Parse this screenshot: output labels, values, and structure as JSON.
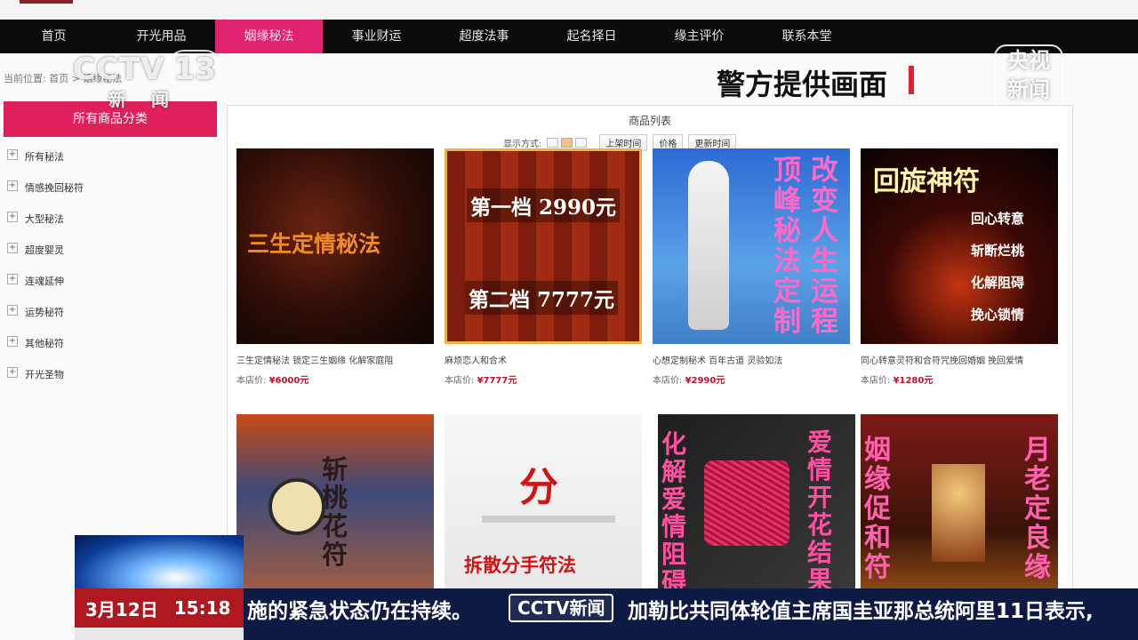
{
  "nav": {
    "items": [
      "首页",
      "开光用品",
      "姻缘秘法",
      "事业财运",
      "超度法事",
      "起名择日",
      "缘主评价",
      "联系本堂"
    ],
    "active_index": 2
  },
  "breadcrumb": "当前位置: 首页 > 姻缘秘法",
  "sidebar": {
    "header": "所有商品分类",
    "items": [
      "所有秘法",
      "情感挽回秘符",
      "大型秘法",
      "超度婴灵",
      "连魂延伸",
      "运势秘符",
      "其他秘符",
      "开光圣物"
    ]
  },
  "panel": {
    "title": "商品列表",
    "sort_label": "显示方式:",
    "sort_buttons": [
      "上架时间",
      "价格",
      "更新时间"
    ]
  },
  "products": [
    {
      "thumb_text": "三生定情秘法",
      "name": "三生定情秘法 锁定三生姻缘 化解家庭阻",
      "price_label": "本店价:",
      "price": "¥6000元"
    },
    {
      "thumb_text_1": "第一档 2990元",
      "thumb_text_2": "第二档 7777元",
      "name": "麻烦恋人和合术",
      "price_label": "本店价:",
      "price": "¥7777元"
    },
    {
      "thumb_text_1": "改变人生运程",
      "thumb_text_2": "顶峰秘法定制",
      "name": "心想定制秘术 百年古道 灵验如法",
      "price_label": "本店价:",
      "price": "¥2990元"
    },
    {
      "thumb_text": "回旋神符",
      "thumb_sub": [
        "回心转意",
        "斩断烂桃",
        "化解阻碍",
        "挽心锁情"
      ],
      "name": "同心转意灵符和合符咒挽回婚姻 挽回爱情",
      "price_label": "本店价:",
      "price": "¥1280元"
    },
    {
      "thumb_text": "斩桃花符"
    },
    {
      "thumb_text": "分",
      "thumb_sub": "拆散分手符法"
    },
    {
      "thumb_text_1": "化解爱情阻碍",
      "thumb_text_2": "爱情开花结果"
    },
    {
      "thumb_text_1": "姻缘促和符",
      "thumb_text_2": "月老定良缘"
    }
  ],
  "overlay": {
    "channel_logo": "CCTV",
    "channel_num": "13",
    "channel_sub": "新闻",
    "caption": "警方提供画面",
    "corner_logo": [
      "央视",
      "新闻"
    ]
  },
  "ticker": {
    "date": "3月12日",
    "time": "15:18",
    "text_left": "施的紧急状态仍在持续。",
    "logo": "CCTV新闻",
    "text_right": "加勒比共同体轮值主席国圭亚那总统阿里11日表示,"
  }
}
